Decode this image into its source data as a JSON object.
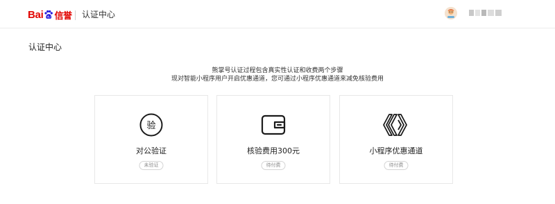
{
  "header": {
    "logo_text_bai": "Bai",
    "logo_text_brand": "信誉",
    "title": "认证中心"
  },
  "page": {
    "title": "认证中心",
    "description_line1": "熊掌号认证过程包含真实性认证和收费两个步骤",
    "description_line2": "现对智能小程序用户开启优惠通道，您可通过小程序优惠通道来减免核验费用"
  },
  "cards": [
    {
      "label": "对公验证",
      "badge": "未验证",
      "icon": "verify-circle-icon",
      "icon_text": "验"
    },
    {
      "label": "核验费用300元",
      "badge": "待付费",
      "icon": "wallet-icon"
    },
    {
      "label": "小程序优惠通道",
      "badge": "待付费",
      "icon": "mini-program-channel-icon"
    }
  ],
  "colors": {
    "brand": "#e10602",
    "border": "#e8e8e8",
    "badge_text": "#8c8c8c"
  }
}
